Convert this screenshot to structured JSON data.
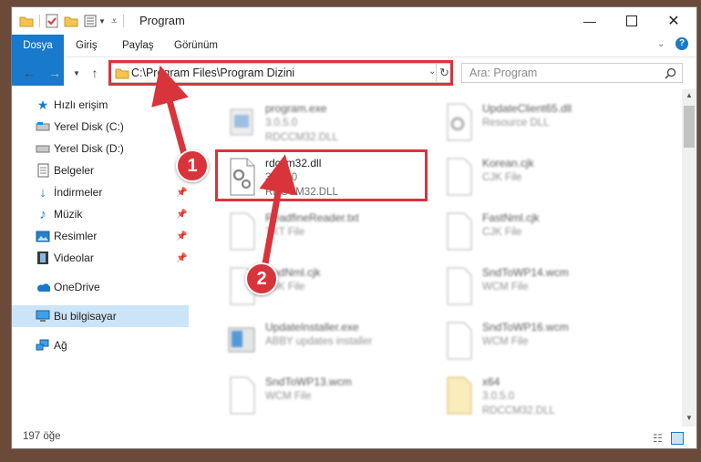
{
  "window": {
    "title": "Program"
  },
  "ribbon": {
    "tabs": [
      "Dosya",
      "Giriş",
      "Paylaş",
      "Görünüm"
    ]
  },
  "address": {
    "path": "C:\\Program Files\\Program Dizini"
  },
  "search": {
    "placeholder": "Ara: Program"
  },
  "sidebar": {
    "items": [
      {
        "label": "Hızlı erişim",
        "icon": "star-icon"
      },
      {
        "label": "Yerel Disk (C:)",
        "icon": "drive-icon"
      },
      {
        "label": "Yerel Disk (D:)",
        "icon": "drive-icon"
      },
      {
        "label": "Belgeler",
        "icon": "documents-icon"
      },
      {
        "label": "İndirmeler",
        "icon": "download-icon"
      },
      {
        "label": "Müzik",
        "icon": "music-icon"
      },
      {
        "label": "Resimler",
        "icon": "pictures-icon"
      },
      {
        "label": "Videolar",
        "icon": "videos-icon"
      },
      {
        "label": "OneDrive",
        "icon": "cloud-icon"
      },
      {
        "label": "Bu bilgisayar",
        "icon": "computer-icon"
      },
      {
        "label": "Ağ",
        "icon": "network-icon"
      }
    ]
  },
  "files": [
    {
      "name": "program.exe",
      "line2": "3.0.5.0",
      "line3": "RDCCM32.DLL"
    },
    {
      "name": "UpdateClient65.dll",
      "line2": "Resource DLL",
      "line3": ""
    },
    {
      "name": "rdccm32.dll",
      "line2": "3.0.5.0",
      "line3": "RDCCM32.DLL"
    },
    {
      "name": "Korean.cjk",
      "line2": "CJK File",
      "line3": ""
    },
    {
      "name": "ReadfineReader.txt",
      "line2": "TXT File",
      "line3": ""
    },
    {
      "name": "FastNml.cjk",
      "line2": "CJK File",
      "line3": ""
    },
    {
      "name": "SndNml.cjk",
      "line2": "CJK File",
      "line3": ""
    },
    {
      "name": "SndToWP14.wcm",
      "line2": "WCM File",
      "line3": ""
    },
    {
      "name": "UpdateInstaller.exe",
      "line2": "ABBY updates installer",
      "line3": ""
    },
    {
      "name": "SndToWP16.wcm",
      "line2": "WCM File",
      "line3": ""
    },
    {
      "name": "SndToWP13.wcm",
      "line2": "WCM File",
      "line3": ""
    },
    {
      "name": "x64",
      "line2": "3.0.5.0",
      "line3": "RDCCM32.DLL"
    }
  ],
  "callouts": [
    "1",
    "2"
  ],
  "status": {
    "count": "197 öğe"
  },
  "colors": {
    "accent": "#1979ca",
    "highlight": "#d9343c",
    "selected": "#cce4f7"
  }
}
